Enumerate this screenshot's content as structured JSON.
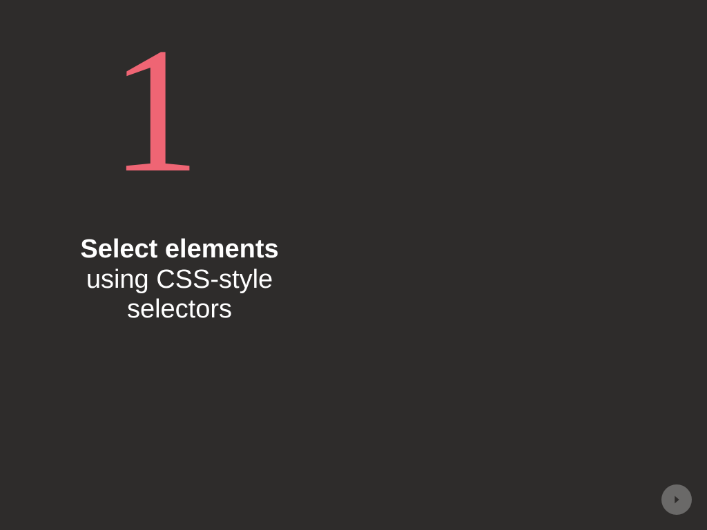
{
  "slide": {
    "number": "1",
    "title_bold": "Select elements",
    "title_line2": "using CSS-style",
    "title_line3": "selectors"
  },
  "colors": {
    "background": "#2e2c2b",
    "accent": "#ef6574",
    "text": "#ffffff",
    "button": "#6a6968"
  },
  "nav": {
    "next_icon": "arrow-right-circle"
  }
}
